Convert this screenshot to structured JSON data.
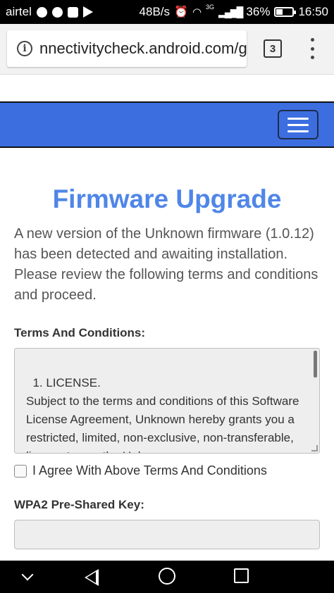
{
  "status_bar": {
    "carrier": "airtel",
    "network_speed": "48B/s",
    "network_type": "3G",
    "battery": "36%",
    "time": "16:50",
    "icons": [
      "whatsapp-icon",
      "phone-icon",
      "square-icon",
      "play-store-icon",
      "alarm-icon",
      "wifi-icon",
      "signal-icon",
      "battery-icon"
    ]
  },
  "browser": {
    "url": "nnectivitycheck.android.com/g",
    "tab_count": "3"
  },
  "page": {
    "title": "Firmware Upgrade",
    "description": "A new version of the Unknown firmware (1.0.12) has been detected and awaiting installation. Please review the following terms and conditions and proceed.",
    "terms_label": "Terms And Conditions:",
    "terms_text": "1. LICENSE.\nSubject to the terms and conditions of this Software License Agreement, Unknown hereby grants you a restricted, limited, non-exclusive, non-transferable, license to use the Unknown Firmware/Software/Driver solely in conjunction",
    "agree_label": "I Agree With Above Terms And Conditions",
    "psk_label": "WPA2 Pre-Shared Key:",
    "psk_value": ""
  },
  "colors": {
    "navbar": "#3d6ee0",
    "title": "#4f86e8"
  }
}
